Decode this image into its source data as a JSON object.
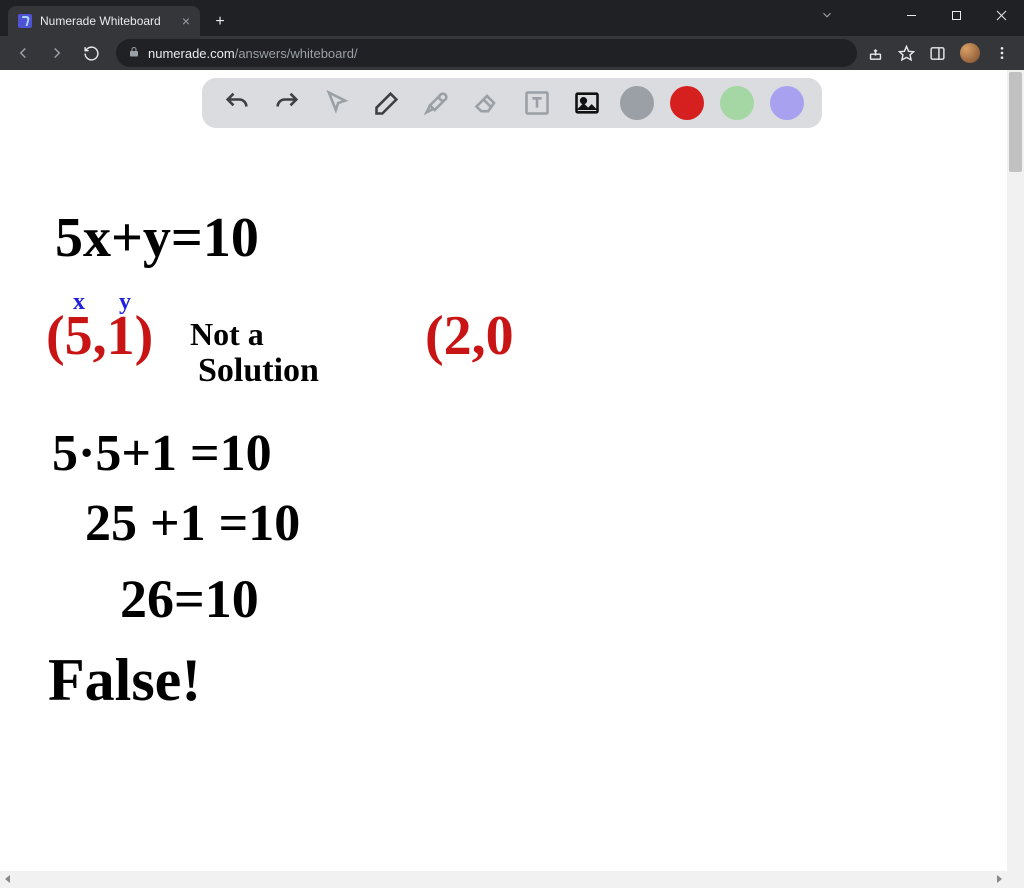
{
  "browser": {
    "tab_title": "Numerade Whiteboard",
    "url_host": "numerade.com",
    "url_path": "/answers/whiteboard/",
    "new_tab_label": "+",
    "tab_close_label": "×"
  },
  "toolbar": {
    "undo_icon": "undo",
    "redo_icon": "redo",
    "pointer_icon": "pointer",
    "pencil_icon": "pencil",
    "tools_icon": "wrench-hammer",
    "eraser_icon": "eraser",
    "text_icon": "text-box",
    "image_icon": "image",
    "colors": {
      "gray": "#9aa0a6",
      "red": "#d62020",
      "green": "#a4d7a4",
      "purple": "#a7a1f0"
    },
    "active_tool": "image"
  },
  "whiteboard": {
    "equation": "5x+y=10",
    "point1_label_x": "x",
    "point1_label_y": "y",
    "point1": "(5,1)",
    "point1_note_line1": "Not a",
    "point1_note_line2": "Solution",
    "point2": "(2,0",
    "work_line1": "5·5+1 =10",
    "work_line2": "25 +1 =10",
    "work_line3": "26=10",
    "conclusion": "False!"
  },
  "colors": {
    "ink_black": "#000000",
    "ink_red": "#c81414",
    "ink_blue": "#2020e0"
  }
}
